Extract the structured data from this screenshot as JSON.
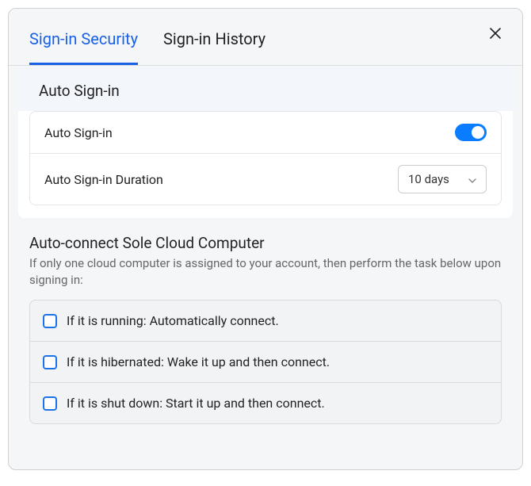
{
  "tabs": {
    "security": "Sign-in Security",
    "history": "Sign-in History"
  },
  "autoSignIn": {
    "header": "Auto Sign-in",
    "toggleLabel": "Auto Sign-in",
    "durationLabel": "Auto Sign-in Duration",
    "durationValue": "10 days"
  },
  "autoConnect": {
    "title": "Auto-connect Sole Cloud Computer",
    "description": "If only one cloud computer is assigned to your account, then perform the task below upon signing in:",
    "options": [
      "If it is running: Automatically connect.",
      "If it is hibernated: Wake it up and then connect.",
      "If it is shut down: Start it up and then connect."
    ]
  }
}
